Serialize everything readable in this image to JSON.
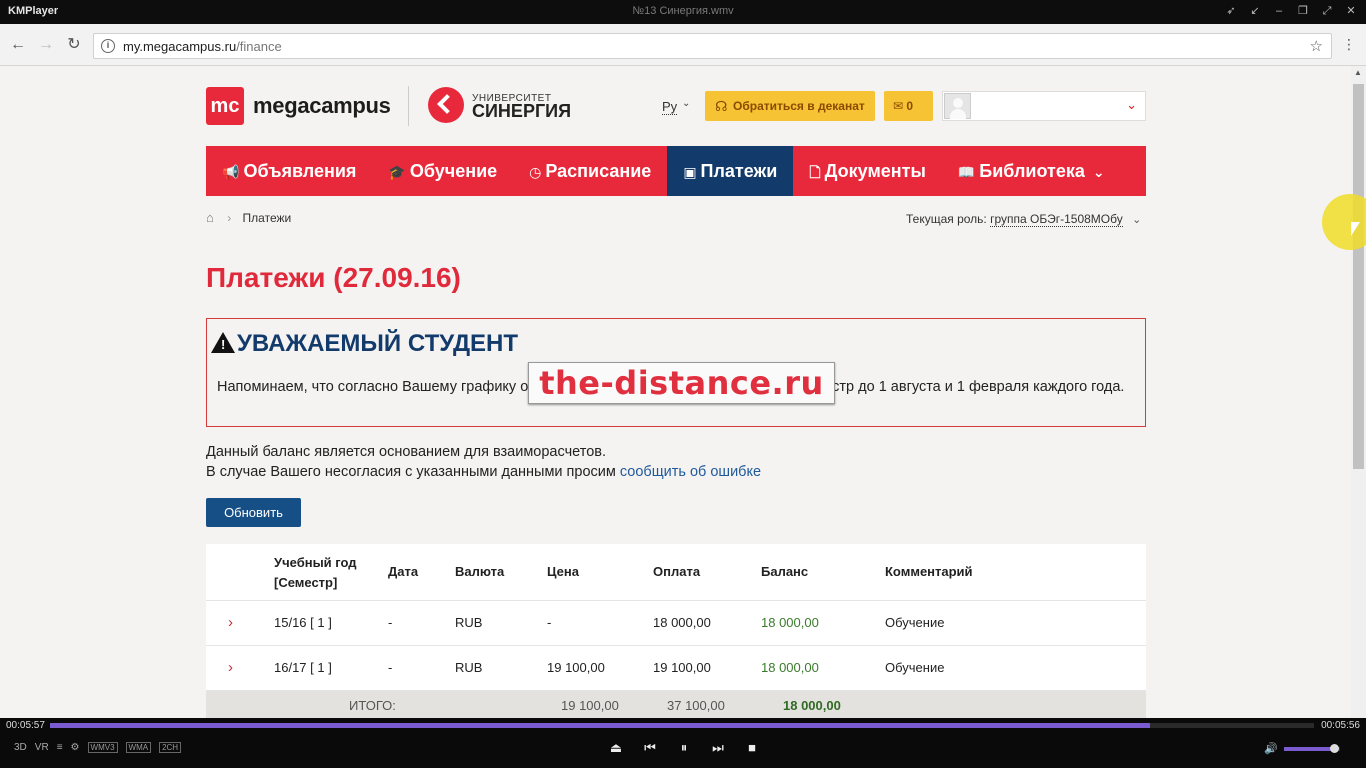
{
  "player": {
    "app_name": "KMPlayer",
    "file_name": "№13 Синергия.wmv",
    "time_elapsed": "00:05:57",
    "time_total": "00:05:56",
    "progress": 0.87,
    "volume": 0.9,
    "left_tags": [
      "3D",
      "VR",
      "WMV3",
      "WMA",
      "2CH"
    ]
  },
  "browser": {
    "url_host": "my.megacampus.ru",
    "url_path": "/finance"
  },
  "header": {
    "logo_mark": "mc",
    "logo_text": "megacampus",
    "synergy_small": "УНИВЕРСИТЕТ",
    "synergy_big": "СИНЕРГИЯ",
    "lang": "Ру",
    "dekanat_label": "Обратиться в деканат",
    "mail_count": "0"
  },
  "nav": {
    "items": [
      {
        "label": "Объявления",
        "icon": "megaphone-icon"
      },
      {
        "label": "Обучение",
        "icon": "graduation-cap-icon"
      },
      {
        "label": "Расписание",
        "icon": "clock-icon"
      },
      {
        "label": "Платежи",
        "icon": "money-icon",
        "active": true
      },
      {
        "label": "Документы",
        "icon": "document-icon"
      },
      {
        "label": "Библиотека",
        "icon": "book-icon"
      }
    ]
  },
  "breadcrumb": {
    "current": "Платежи"
  },
  "role": {
    "label": "Текущая роль:",
    "value": "группа ОБЭг-1508МОбу"
  },
  "page": {
    "title": "Платежи (27.09.16)",
    "alert_title": "УВАЖАЕМЫЙ СТУДЕНТ",
    "alert_text": "Напоминаем, что согласно Вашему графику обучения необходимо вносить оплату за семестр до 1 августа и 1 февраля каждого года.",
    "info_line1": "Данный баланс является основанием для взаиморасчетов.",
    "info_line2": "В случае Вашего несогласия с указанными данными просим ",
    "info_link": "сообщить об ошибке",
    "refresh_label": "Обновить",
    "watermark": "the-distance.ru"
  },
  "table": {
    "headers": {
      "year": "Учебный год",
      "semester": "[Семестр]",
      "date": "Дата",
      "currency": "Валюта",
      "price": "Цена",
      "payment": "Оплата",
      "balance": "Баланс",
      "comment": "Комментарий"
    },
    "rows": [
      {
        "year": "15/16 [ 1 ]",
        "date": "-",
        "currency": "RUB",
        "price": "-",
        "payment": "18 000,00",
        "balance": "18 000,00",
        "comment": "Обучение"
      },
      {
        "year": "16/17 [ 1 ]",
        "date": "-",
        "currency": "RUB",
        "price": "19 100,00",
        "payment": "19 100,00",
        "balance": "18 000,00",
        "comment": "Обучение"
      }
    ],
    "total": {
      "label": "ИТОГО:",
      "price": "19 100,00",
      "payment": "37 100,00",
      "balance": "18 000,00"
    }
  }
}
